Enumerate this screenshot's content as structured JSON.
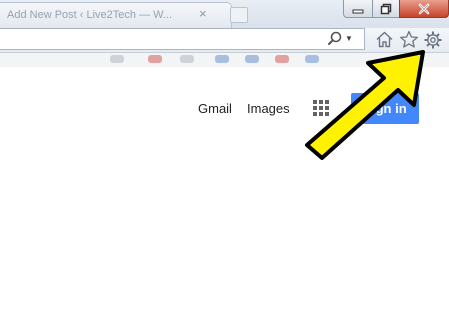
{
  "browser": {
    "tab_title": "Add New Post ‹ Live2Tech — W...",
    "tab_close": "×"
  },
  "google": {
    "gmail_label": "Gmail",
    "images_label": "Images",
    "signin_label": "Sign in"
  },
  "icons": {
    "home": "home-icon",
    "favorites": "star-icon",
    "tools": "gear-icon",
    "apps": "apps-grid-icon",
    "search": "search-icon"
  },
  "colors": {
    "signin_button": "#4387fd",
    "close_button": "#c7432b",
    "arrow_fill": "#fff200",
    "arrow_outline": "#000000"
  }
}
